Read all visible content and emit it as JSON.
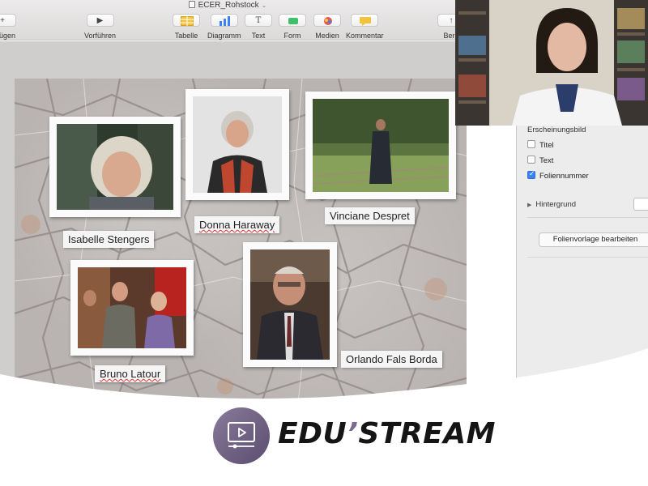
{
  "window": {
    "document_title": "ECER_Rohstock"
  },
  "toolbar": {
    "items": [
      {
        "label": "zufügen",
        "icon": "plus-icon"
      },
      {
        "label": "Vorführen",
        "icon": "play-icon"
      },
      {
        "label": "Tabelle",
        "icon": "table-icon"
      },
      {
        "label": "Diagramm",
        "icon": "chart-icon"
      },
      {
        "label": "Text",
        "icon": "text-icon"
      },
      {
        "label": "Form",
        "icon": "shape-icon"
      },
      {
        "label": "Medien",
        "icon": "media-icon"
      },
      {
        "label": "Kommentar",
        "icon": "comment-icon"
      },
      {
        "label": "Bere",
        "icon": "share-icon"
      }
    ]
  },
  "slide": {
    "captions": [
      "Isabelle Stengers",
      "Donna Haraway",
      "Vinciane Despret",
      "Bruno Latour",
      "Orlando Fals Borda"
    ],
    "colors": {
      "photo_frame": "#fbfbfb",
      "caption_bg": "#f5f5f5"
    }
  },
  "inspector": {
    "heading": "Erscheinungsbild",
    "checkboxes": [
      {
        "label": "Titel",
        "checked": false
      },
      {
        "label": "Text",
        "checked": false
      },
      {
        "label": "Foliennummer",
        "checked": true
      }
    ],
    "background_label": "Hintergrund",
    "edit_master_button": "Folienvorlage bearbeiten"
  },
  "branding": {
    "logo_text_a": "EDU",
    "logo_apostrophe": "’",
    "logo_text_b": "STREAM",
    "colors": {
      "logo_purple": "#7b6a8f"
    }
  }
}
